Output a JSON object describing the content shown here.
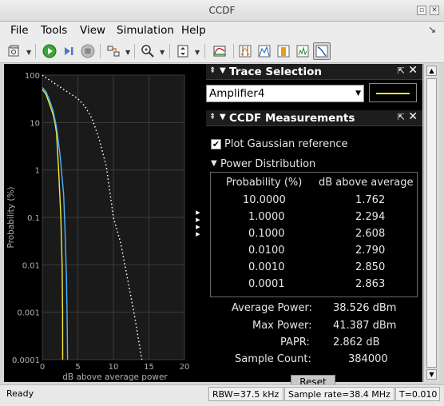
{
  "window": {
    "title": "CCDF"
  },
  "menu": {
    "items": [
      "File",
      "Tools",
      "View",
      "Simulation",
      "Help"
    ]
  },
  "trace_selection": {
    "title": "Trace Selection",
    "selected": "Amplifier4",
    "line_color": "#f2ea38"
  },
  "measurements": {
    "title": "CCDF Measurements",
    "plot_gaussian_label": "Plot Gaussian reference",
    "plot_gaussian_checked": true,
    "power_distribution_label": "Power Distribution",
    "col_probability": "Probability (%)",
    "col_db": "dB above average",
    "rows": [
      {
        "prob": "10.0000",
        "db": "1.762"
      },
      {
        "prob": "1.0000",
        "db": "2.294"
      },
      {
        "prob": "0.1000",
        "db": "2.608"
      },
      {
        "prob": "0.0100",
        "db": "2.790"
      },
      {
        "prob": "0.0010",
        "db": "2.850"
      },
      {
        "prob": "0.0001",
        "db": "2.863"
      }
    ],
    "average_power_label": "Average Power:",
    "average_power_value": "38.526 dBm",
    "max_power_label": "Max Power:",
    "max_power_value": "41.387 dBm",
    "papr_label": "PAPR:",
    "papr_value": "2.862 dB",
    "sample_count_label": "Sample Count:",
    "sample_count_value": "384000",
    "reset_label": "Reset"
  },
  "status": {
    "ready": "Ready",
    "rbw": "RBW=37.5 kHz",
    "sample_rate": "Sample rate=38.4 MHz",
    "time": "T=0.010"
  },
  "chart_data": {
    "type": "line",
    "xlabel": "dB above average power",
    "ylabel": "Probability (%)",
    "xlim": [
      0,
      20
    ],
    "ylim": [
      0.0001,
      100
    ],
    "yscale": "log",
    "x_ticks": [
      "0",
      "5",
      "10",
      "15",
      "20"
    ],
    "y_ticks": [
      "0.0001",
      "0.001",
      "0.01",
      "0.1",
      "1",
      "10",
      "100"
    ],
    "grid": true,
    "series": [
      {
        "color": "#f2ea38",
        "style": "solid",
        "x": [
          0.0,
          0.5,
          1.0,
          1.5,
          1.762,
          2.0,
          2.294,
          2.608,
          2.79,
          2.85,
          2.863
        ],
        "y": [
          50,
          40,
          25,
          15,
          10,
          6,
          1,
          0.1,
          0.01,
          0.001,
          0.0001
        ]
      },
      {
        "color": "#4fb3ff",
        "style": "solid",
        "x": [
          0.0,
          0.5,
          1.0,
          1.5,
          2.0,
          2.5,
          3.0,
          3.2,
          3.4,
          3.5,
          3.55
        ],
        "y": [
          55,
          45,
          30,
          18,
          8,
          2,
          0.3,
          0.05,
          0.005,
          0.0005,
          0.0001
        ]
      },
      {
        "color": "#ffffff",
        "style": "dotted",
        "x": [
          0,
          1,
          2,
          3,
          4,
          5,
          6,
          7,
          8,
          9,
          10,
          11,
          12,
          13,
          14
        ],
        "y": [
          100,
          79,
          63,
          50,
          40,
          32,
          22,
          12,
          4.5,
          1.2,
          0.1,
          0.03,
          0.005,
          0.0008,
          0.0001
        ]
      }
    ]
  },
  "icons": {
    "toolbar": [
      "new-scope-icon",
      "run-icon",
      "step-icon",
      "stop-icon",
      "highlight-icon",
      "zoom-in-icon",
      "scale-axes-icon",
      "style-icon",
      "cursor-icon",
      "peak-icon",
      "bandwidth-icon",
      "spectrum-icon",
      "ccdf-icon"
    ]
  }
}
